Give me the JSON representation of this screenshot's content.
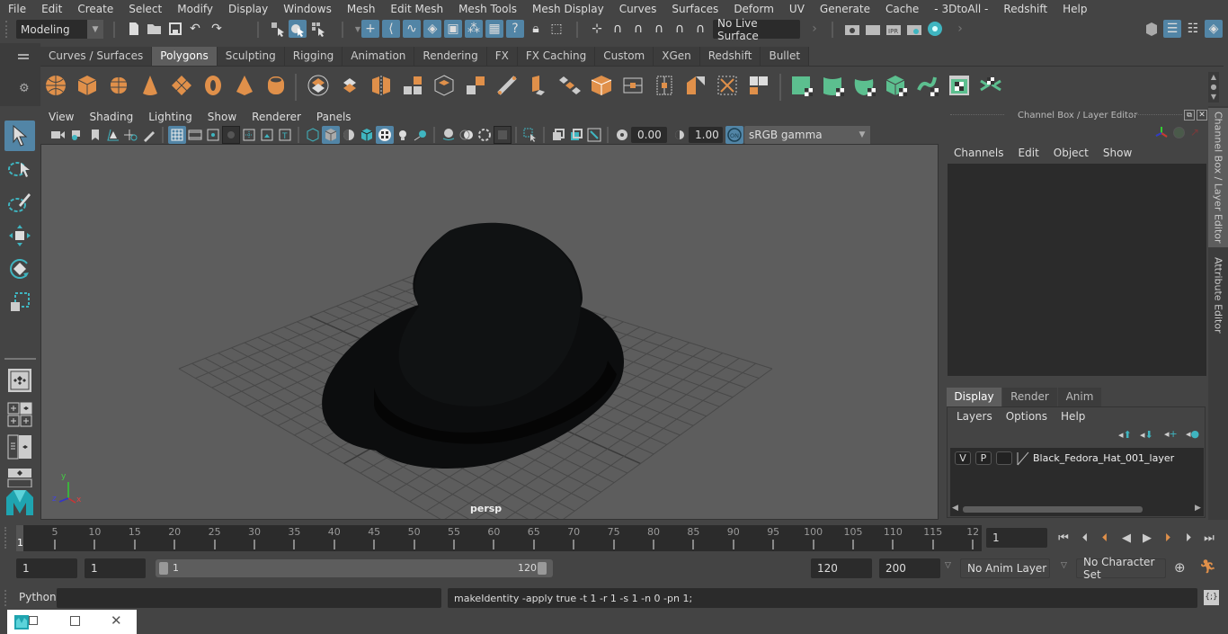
{
  "menubar": {
    "items": [
      "File",
      "Edit",
      "Create",
      "Select",
      "Modify",
      "Display",
      "Windows",
      "Mesh",
      "Edit Mesh",
      "Mesh Tools",
      "Mesh Display",
      "Curves",
      "Surfaces",
      "Deform",
      "UV",
      "Generate",
      "Cache",
      "- 3DtoAll -",
      "Redshift",
      "Help"
    ]
  },
  "statusline": {
    "mode_dropdown": "Modeling",
    "live_surface": "No Live Surface"
  },
  "shelf": {
    "tabs": [
      "Curves / Surfaces",
      "Polygons",
      "Sculpting",
      "Rigging",
      "Animation",
      "Rendering",
      "FX",
      "FX Caching",
      "Custom",
      "XGen",
      "Redshift",
      "Bullet"
    ],
    "active_tab": "Polygons"
  },
  "viewport": {
    "menu": [
      "View",
      "Shading",
      "Lighting",
      "Show",
      "Renderer",
      "Panels"
    ],
    "exposure": "0.00",
    "gamma": "1.00",
    "color_mgmt_badge": "ON",
    "color_space": "sRGB gamma",
    "camera_label": "persp",
    "axis": {
      "x": "x",
      "y": "y",
      "z": "z"
    },
    "object": "Black Fedora Hat"
  },
  "channel_box": {
    "title": "Channel Box / Layer Editor",
    "menu": [
      "Channels",
      "Edit",
      "Object",
      "Show"
    ],
    "layer_tabs": [
      "Display",
      "Render",
      "Anim"
    ],
    "active_layer_tab": "Display",
    "layer_menu": [
      "Layers",
      "Options",
      "Help"
    ],
    "layers": [
      {
        "visible": "V",
        "playback": "P",
        "type": "",
        "name": "Black_Fedora_Hat_001_layer"
      }
    ]
  },
  "side_tabs": [
    "Channel Box / Layer Editor",
    "Attribute Editor"
  ],
  "timeline": {
    "ticks": [
      "5",
      "10",
      "15",
      "20",
      "25",
      "30",
      "35",
      "40",
      "45",
      "50",
      "55",
      "60",
      "65",
      "70",
      "75",
      "80",
      "85",
      "90",
      "95",
      "100",
      "105",
      "110",
      "115",
      "12"
    ],
    "current_frame_marker": "1",
    "current_frame": "1"
  },
  "range": {
    "start": "1",
    "playback_start": "1",
    "slider_start": "1",
    "slider_end": "120",
    "playback_end": "120",
    "end": "200",
    "anim_layer": "No Anim Layer",
    "character_set": "No Character Set"
  },
  "cmdline": {
    "language": "Python",
    "input": "",
    "result": "makeIdentity -apply true -t 1 -r 1 -s 1 -n 0 -pn 1;"
  },
  "colors": {
    "accent_blue": "#5285a6",
    "shelf_orange": "#e0904a",
    "shelf_green": "#5cbf8f",
    "teal": "#3fb5c0"
  }
}
